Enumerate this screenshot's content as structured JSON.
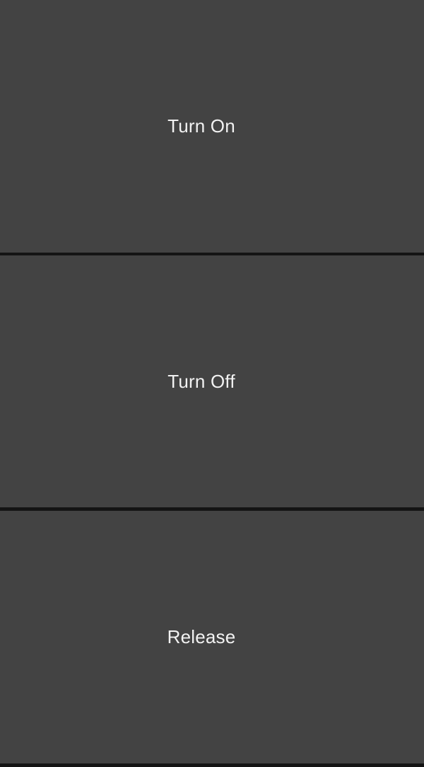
{
  "buttons": {
    "turn_on": {
      "label": "Turn On"
    },
    "turn_off": {
      "label": "Turn Off"
    },
    "release": {
      "label": "Release"
    }
  },
  "colors": {
    "button_background": "#434343",
    "divider": "#141414",
    "text": "#f2f2f2"
  }
}
